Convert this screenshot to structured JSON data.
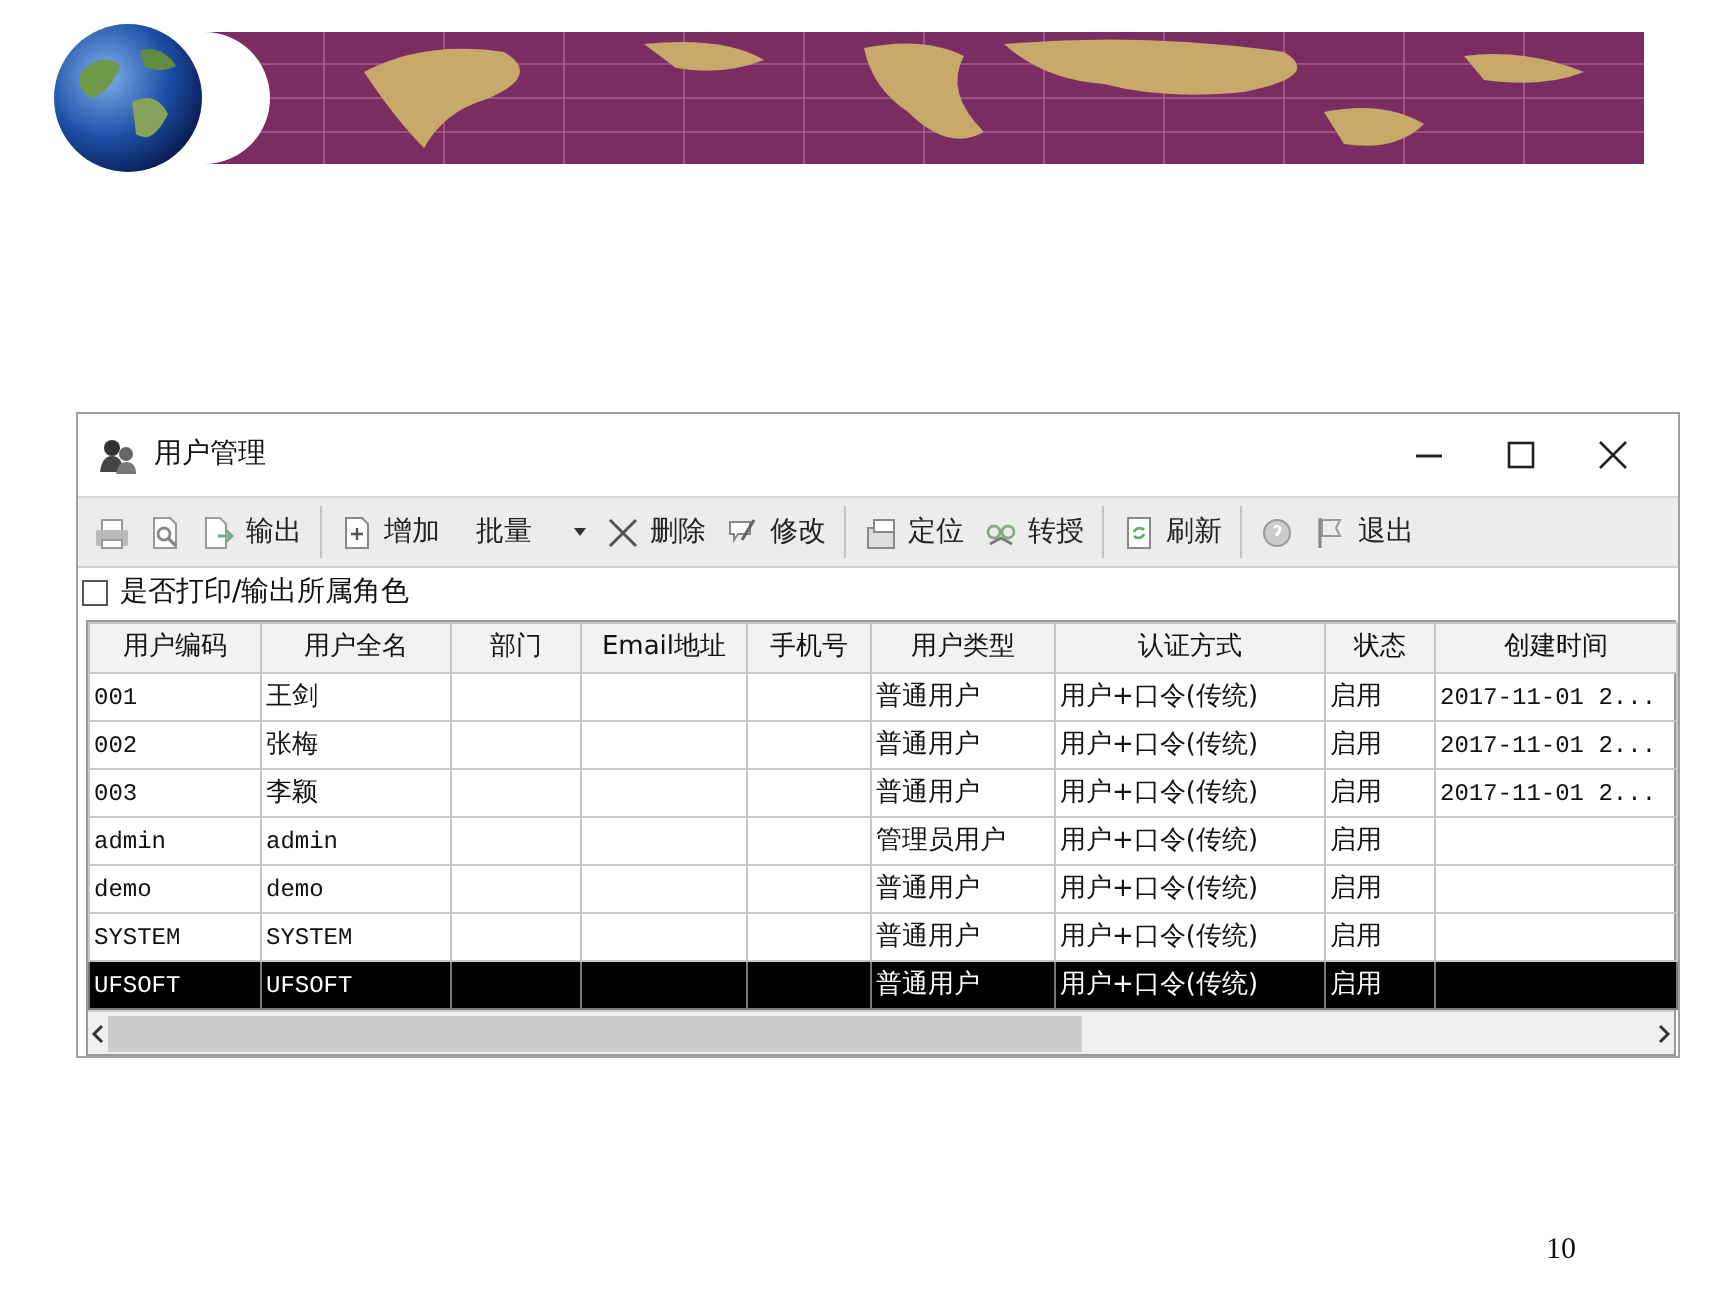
{
  "slide": {
    "page_number": "10"
  },
  "window": {
    "title": "用户管理"
  },
  "toolbar": [
    {
      "kind": "icon"
    },
    {
      "kind": "icon"
    },
    {
      "kind": "button",
      "label": "输出"
    },
    {
      "kind": "separator"
    },
    {
      "kind": "button",
      "label": "增加"
    },
    {
      "kind": "dropdown",
      "label": "批量"
    },
    {
      "kind": "button",
      "label": "删除"
    },
    {
      "kind": "button",
      "label": "修改"
    },
    {
      "kind": "separator"
    },
    {
      "kind": "button",
      "label": "定位"
    },
    {
      "kind": "button",
      "label": "转授"
    },
    {
      "kind": "separator"
    },
    {
      "kind": "button",
      "label": "刷新"
    },
    {
      "kind": "separator"
    },
    {
      "kind": "icon"
    },
    {
      "kind": "button",
      "label": "退出"
    }
  ],
  "option": {
    "label": "是否打印/输出所属角色",
    "checked": false
  },
  "table": {
    "columns": [
      "用户编码",
      "用户全名",
      "部门",
      "Email地址",
      "手机号",
      "用户类型",
      "认证方式",
      "状态",
      "创建时间"
    ],
    "rows": [
      {
        "selected": false,
        "cells": [
          "001",
          "王剑",
          null,
          null,
          null,
          "普通用户",
          "用户+口令(传统)",
          "启用",
          "2017-11-01 2..."
        ]
      },
      {
        "selected": false,
        "cells": [
          "002",
          "张梅",
          null,
          null,
          null,
          "普通用户",
          "用户+口令(传统)",
          "启用",
          "2017-11-01 2..."
        ]
      },
      {
        "selected": false,
        "cells": [
          "003",
          "李颖",
          null,
          null,
          null,
          "普通用户",
          "用户+口令(传统)",
          "启用",
          "2017-11-01 2..."
        ]
      },
      {
        "selected": false,
        "cells": [
          "admin",
          "admin",
          null,
          null,
          null,
          "管理员用户",
          "用户+口令(传统)",
          "启用",
          null
        ]
      },
      {
        "selected": false,
        "cells": [
          "demo",
          "demo",
          null,
          null,
          null,
          "普通用户",
          "用户+口令(传统)",
          "启用",
          null
        ]
      },
      {
        "selected": false,
        "cells": [
          "SYSTEM",
          "SYSTEM",
          null,
          null,
          null,
          "普通用户",
          "用户+口令(传统)",
          "启用",
          null
        ]
      },
      {
        "selected": true,
        "cells": [
          "UFSOFT",
          "UFSOFT",
          null,
          null,
          null,
          "普通用户",
          "用户+口令(传统)",
          "启用",
          null
        ]
      }
    ]
  }
}
